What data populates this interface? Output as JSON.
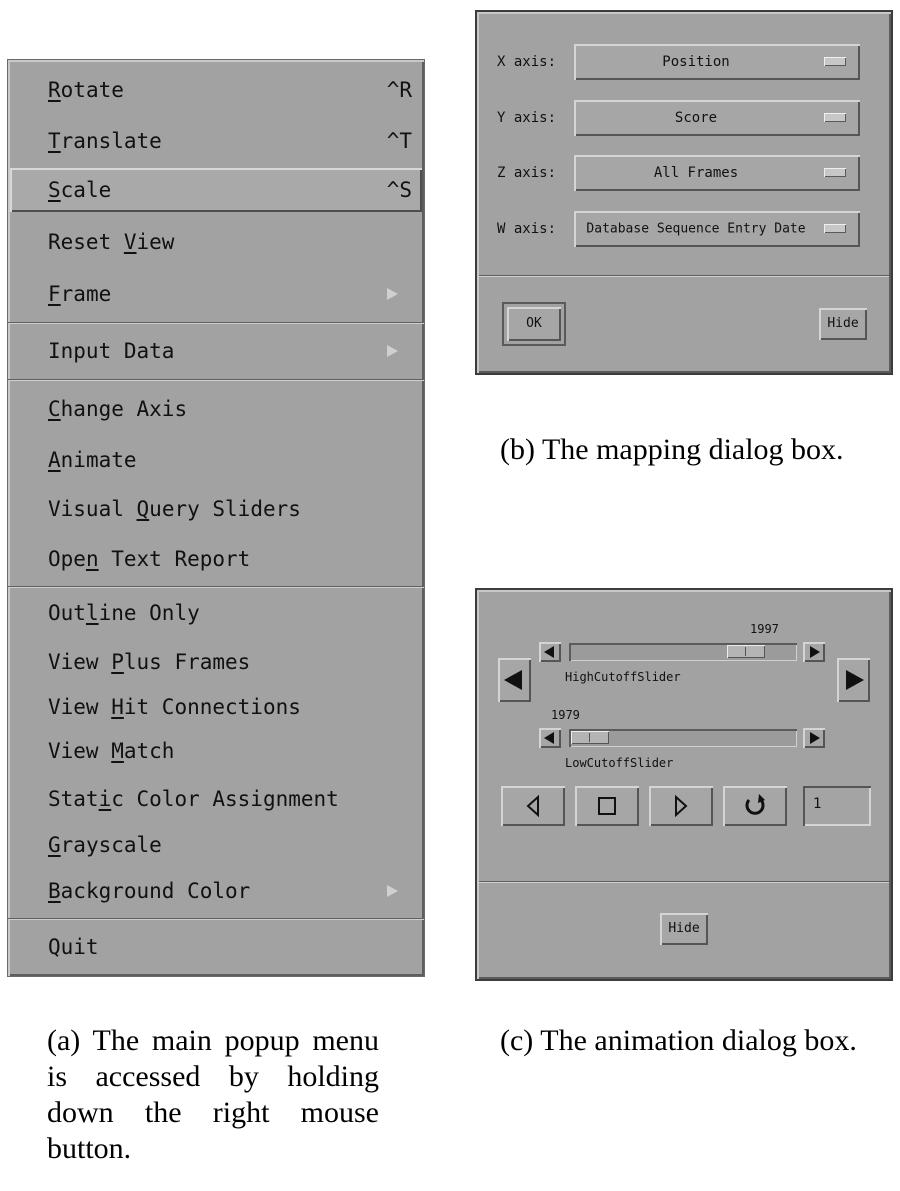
{
  "menu": {
    "items": [
      {
        "pre": "",
        "u": "R",
        "post": "otate",
        "accel": "^R"
      },
      {
        "pre": "",
        "u": "T",
        "post": "ranslate",
        "accel": "^T"
      },
      {
        "pre": "",
        "u": "S",
        "post": "cale",
        "accel": "^S",
        "highlighted": true
      },
      {
        "pre": "Reset ",
        "u": "V",
        "post": "iew"
      },
      {
        "pre": "",
        "u": "F",
        "post": "rame",
        "submenu": true
      },
      {
        "pre": "Input Data",
        "u": "",
        "post": "",
        "submenu": true
      },
      {
        "pre": "",
        "u": "C",
        "post": "hange Axis"
      },
      {
        "pre": "",
        "u": "A",
        "post": "nimate"
      },
      {
        "pre": "Visual ",
        "u": "Q",
        "post": "uery Sliders"
      },
      {
        "pre": "Ope",
        "u": "n",
        "post": " Text Report"
      },
      {
        "pre": "Out",
        "u": "l",
        "post": "ine Only"
      },
      {
        "pre": "View ",
        "u": "P",
        "post": "lus Frames"
      },
      {
        "pre": "View ",
        "u": "H",
        "post": "it Connections"
      },
      {
        "pre": "View ",
        "u": "M",
        "post": "atch"
      },
      {
        "pre": "Stat",
        "u": "i",
        "post": "c Color Assignment"
      },
      {
        "pre": "",
        "u": "G",
        "post": "rayscale"
      },
      {
        "pre": "",
        "u": "B",
        "post": "ackground Color",
        "submenu": true
      },
      {
        "pre": "Quit",
        "u": "",
        "post": ""
      }
    ]
  },
  "mapping": {
    "rows": [
      {
        "label": "X axis:",
        "value": "Position"
      },
      {
        "label": "Y axis:",
        "value": "Score"
      },
      {
        "label": "Z axis:",
        "value": "All Frames"
      },
      {
        "label": "W axis:",
        "value": "Database Sequence Entry Date"
      }
    ],
    "ok_label": "OK",
    "hide_label": "Hide"
  },
  "animation": {
    "high_value": "1997",
    "high_label": "HighCutoffSlider",
    "high_position": 0.84,
    "low_value": "1979",
    "low_label": "LowCutoffSlider",
    "low_position": 0.0,
    "step_value": "1",
    "hide_label": "Hide"
  },
  "captions": {
    "a": "(a) The main popup menu is accessed by holding down the right mouse button.",
    "b": "(b) The mapping dialog box.",
    "c": "(c) The animation dialog box."
  }
}
